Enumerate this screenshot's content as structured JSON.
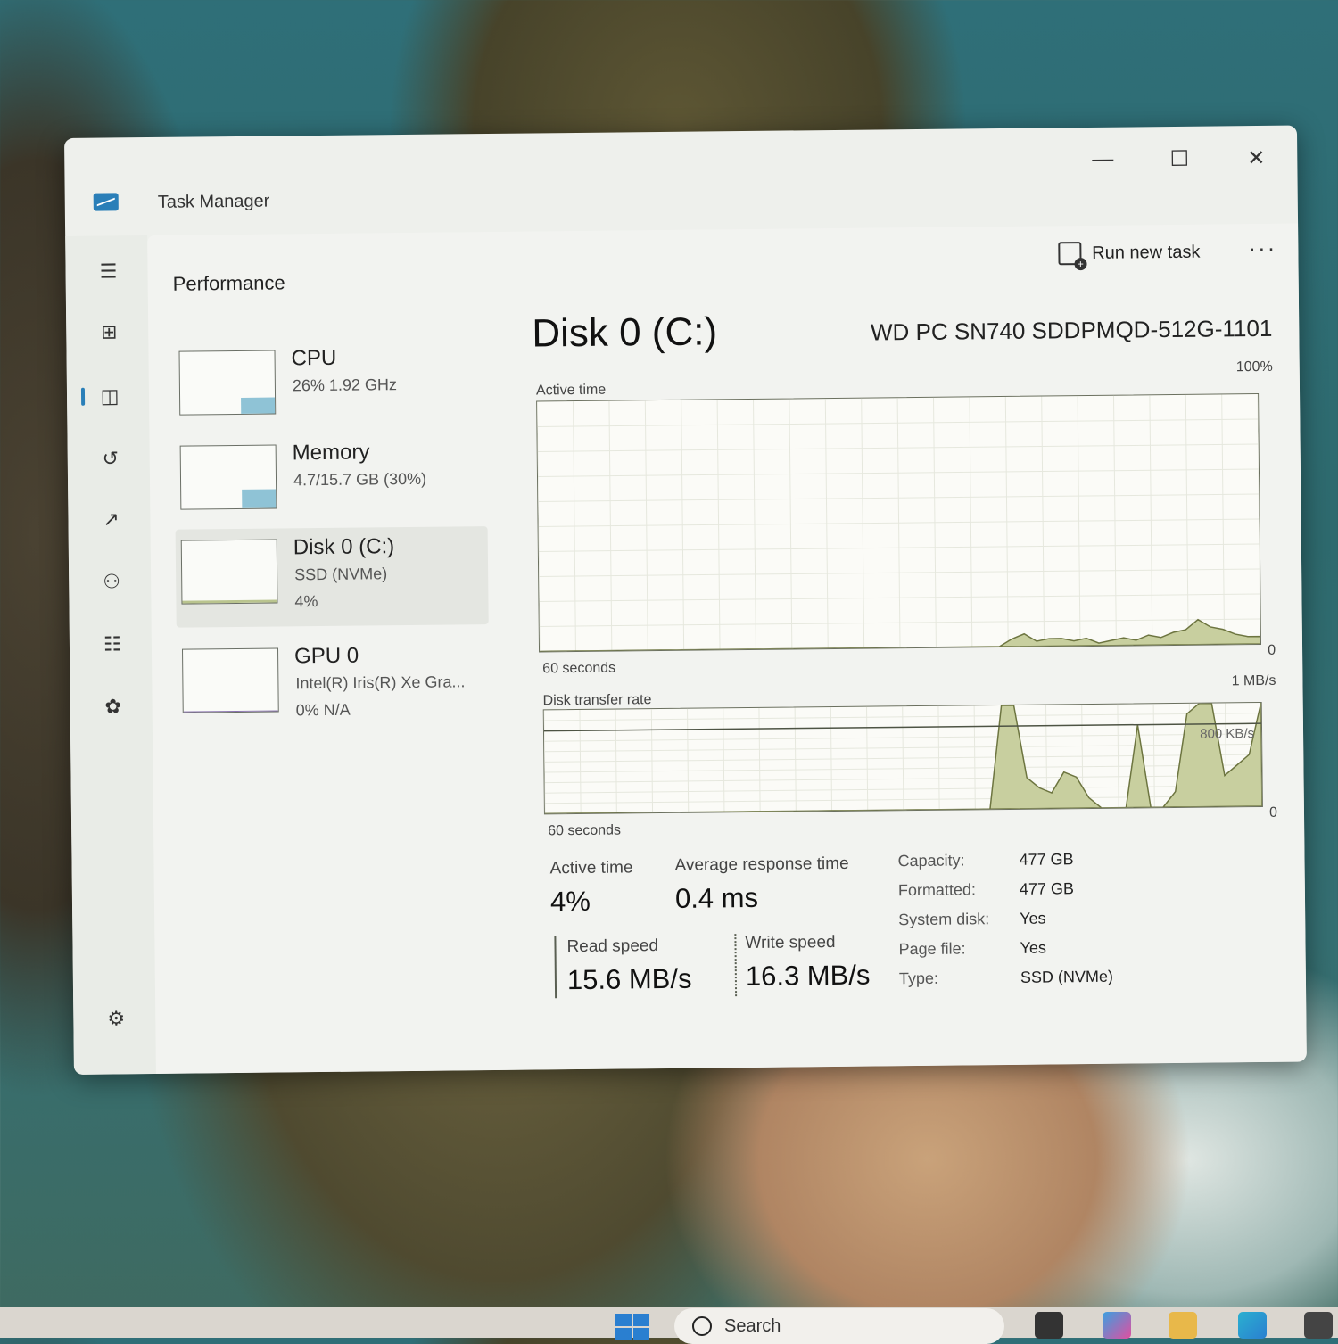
{
  "window": {
    "title": "Task Manager",
    "minimize": "—",
    "maximize": "☐",
    "close": "✕"
  },
  "header": {
    "page_title": "Performance",
    "run_new_task": "Run new task",
    "more": "···"
  },
  "sidebar": {
    "icons": [
      "hamburger-icon",
      "processes-icon",
      "performance-icon",
      "app-history-icon",
      "startup-apps-icon",
      "users-icon",
      "details-icon",
      "services-icon",
      "settings-icon"
    ]
  },
  "devices": [
    {
      "name": "CPU",
      "sub": "26%  1.92 GHz",
      "sub2": "",
      "usage": 0.26,
      "color": "#8fc3d6"
    },
    {
      "name": "Memory",
      "sub": "4.7/15.7 GB (30%)",
      "sub2": "",
      "usage": 0.3,
      "color": "#8fc3d6"
    },
    {
      "name": "Disk 0 (C:)",
      "sub": "SSD (NVMe)",
      "sub2": "4%",
      "usage": 0.04,
      "color": "#b9c48e"
    },
    {
      "name": "GPU 0",
      "sub": "Intel(R) Iris(R) Xe Gra...",
      "sub2": "0%  N/A",
      "usage": 0.0,
      "color": "#8b73b0"
    }
  ],
  "main": {
    "title": "Disk 0 (C:)",
    "model": "WD PC SN740 SDDPMQD-512G-1101",
    "active_time_label": "Active time",
    "active_time_max": "100%",
    "graph_time": "60 seconds",
    "graph_min": "0",
    "transfer_label": "Disk transfer rate",
    "transfer_max": "1 MB/s",
    "transfer_mark": "800 KB/s",
    "stats": {
      "active_time_label": "Active time",
      "active_time_value": "4%",
      "avg_response_label": "Average response time",
      "avg_response_value": "0.4 ms",
      "read_label": "Read speed",
      "read_value": "15.6 MB/s",
      "write_label": "Write speed",
      "write_value": "16.3 MB/s"
    },
    "properties": [
      {
        "k": "Capacity:",
        "v": "477 GB"
      },
      {
        "k": "Formatted:",
        "v": "477 GB"
      },
      {
        "k": "System disk:",
        "v": "Yes"
      },
      {
        "k": "Page file:",
        "v": "Yes"
      },
      {
        "k": "Type:",
        "v": "SSD (NVMe)"
      }
    ]
  },
  "chart_data": [
    {
      "type": "area",
      "title": "Active time",
      "ylim": [
        0,
        100
      ],
      "xlabel": "60 seconds",
      "series": [
        {
          "values": [
            0,
            0,
            0,
            0,
            0,
            0,
            0,
            0,
            0,
            0,
            0,
            0,
            0,
            0,
            0,
            0,
            0,
            0,
            0,
            0,
            0,
            0,
            0,
            0,
            0,
            0,
            0,
            0,
            0,
            0,
            0,
            0,
            0,
            0,
            0,
            0,
            0,
            0,
            3,
            5,
            2,
            3,
            3,
            2,
            3,
            1,
            2,
            3,
            2,
            4,
            3,
            5,
            6,
            10,
            7,
            6,
            4,
            3,
            3
          ]
        }
      ]
    },
    {
      "type": "area",
      "title": "Disk transfer rate",
      "ylim": [
        0,
        1000
      ],
      "xlabel": "60 seconds",
      "series": [
        {
          "values": [
            0,
            0,
            0,
            0,
            0,
            0,
            0,
            0,
            0,
            0,
            0,
            0,
            0,
            0,
            0,
            0,
            0,
            0,
            0,
            0,
            0,
            0,
            0,
            0,
            0,
            0,
            0,
            0,
            0,
            0,
            0,
            0,
            0,
            0,
            0,
            0,
            0,
            1000,
            1000,
            300,
            200,
            150,
            350,
            300,
            100,
            0,
            0,
            0,
            800,
            0,
            0,
            150,
            900,
            1000,
            1000,
            300,
            400,
            500,
            1000
          ]
        }
      ]
    }
  ],
  "taskbar": {
    "search_placeholder": "Search"
  }
}
